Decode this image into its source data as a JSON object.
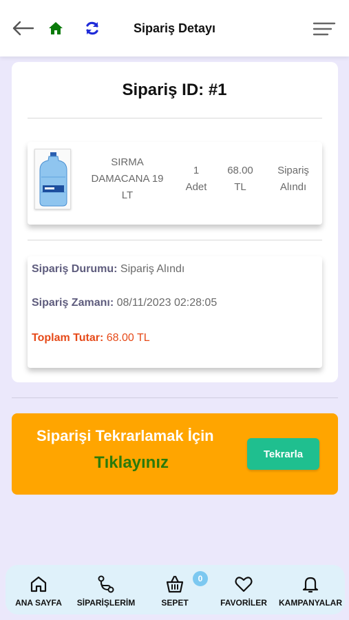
{
  "header": {
    "title": "Sipariş Detayı",
    "icons": [
      "back-arrow-icon",
      "home-icon",
      "refresh-icon",
      "menu-icon"
    ],
    "colors": {
      "home": "#0a7a0a",
      "refresh": "#1f2bd8"
    }
  },
  "order": {
    "id_label": "Sipariş ID: #1",
    "product": {
      "name_line1": "SIRMA",
      "name_line2": "DAMACANA 19",
      "name_line3": "LT",
      "qty_line1": "1",
      "qty_line2": "Adet",
      "price_line1": "68.00",
      "price_line2": "TL",
      "status_line1": "Sipariş",
      "status_line2": "Alındı"
    },
    "status_label": "Sipariş Durumu:",
    "status_value": "Sipariş Alındı",
    "time_label": "Sipariş Zamanı:",
    "time_value": "08/11/2023 02:28:05",
    "total_label": "Toplam Tutar:",
    "total_value": "68.00 TL"
  },
  "repeat": {
    "line1": "Siparişi Tekrarlamak İçin",
    "line2": "Tıklayınız",
    "button": "Tekrarla",
    "colors": {
      "banner": "#ffa500",
      "button": "#1fbf8f",
      "highlight": "#2b7a0b"
    }
  },
  "nav": {
    "items": [
      {
        "label": "ANA SAYFA",
        "icon": "home-outline-icon"
      },
      {
        "label": "SİPARİŞLERİM",
        "icon": "route-icon"
      },
      {
        "label": "SEPET",
        "icon": "basket-icon"
      },
      {
        "label": "FAVORİLER",
        "icon": "heart-icon"
      },
      {
        "label": "KAMPANYALAR",
        "icon": "bell-icon"
      }
    ],
    "cart_count": "0"
  }
}
